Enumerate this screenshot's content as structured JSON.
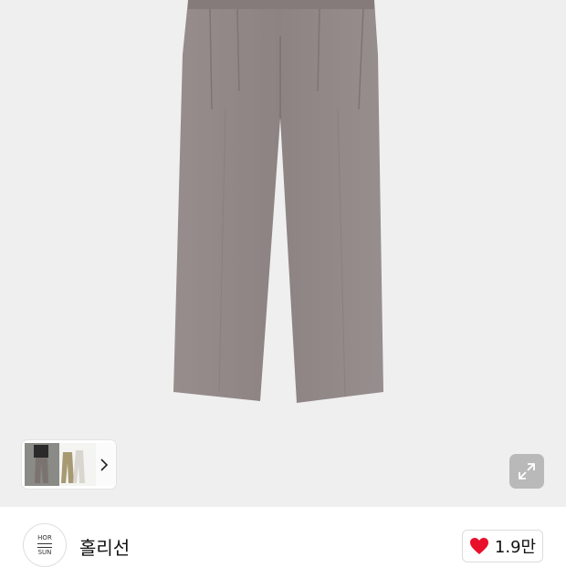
{
  "product": {
    "image_alt": "grey wide-leg pleated trousers",
    "pants_color": "#8f8585",
    "thumbnail_count": 3
  },
  "gallery": {
    "next_icon": "chevron-right-icon",
    "expand_icon": "expand-icon"
  },
  "shop": {
    "logo_top": "HOR",
    "logo_bottom": "SUN",
    "name": "홀리선"
  },
  "like": {
    "icon": "heart-icon",
    "icon_color": "#e8102a",
    "count": "1.9만"
  }
}
